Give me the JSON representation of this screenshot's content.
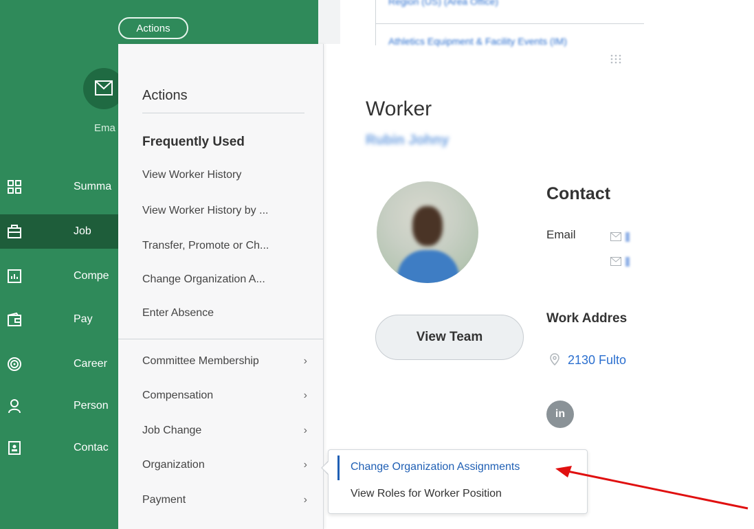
{
  "sidebar": {
    "actions_pill": "Actions",
    "email_label": "Ema",
    "items": [
      {
        "label": "Summa",
        "icon": "summary-grid-icon"
      },
      {
        "label": "Job",
        "icon": "briefcase-icon"
      },
      {
        "label": "Compe",
        "icon": "compensation-chart-icon"
      },
      {
        "label": "Pay",
        "icon": "wallet-icon"
      },
      {
        "label": "Career",
        "icon": "target-icon"
      },
      {
        "label": "Person",
        "icon": "person-icon"
      },
      {
        "label": "Contac",
        "icon": "contact-card-icon"
      }
    ],
    "active_item": "Job"
  },
  "actions_panel": {
    "title": "Actions",
    "frequently_used_heading": "Frequently Used",
    "frequently_used": [
      "View Worker History",
      "View Worker History by ...",
      "Transfer, Promote or Ch...",
      "Change Organization A...",
      "Enter Absence"
    ],
    "categories": [
      "Committee Membership",
      "Compensation",
      "Job Change",
      "Organization",
      "Payment"
    ]
  },
  "submenu": {
    "items": [
      "Change Organization Assignments",
      "View Roles for Worker Position"
    ],
    "selected_index": 0
  },
  "worker": {
    "title": "Worker",
    "name_blurred": "Rubin Johny",
    "view_team_label": "View Team",
    "contact_heading": "Contact",
    "email_label": "Email",
    "work_address_heading": "Work Addres",
    "address_link": "2130 Fulto",
    "linkedin_label": "in"
  },
  "colors": {
    "sidebar_green": "#2f8a5a",
    "sidebar_active": "#1e5d3a",
    "link_blue": "#2b6fcf",
    "annotation_red": "#e01010"
  }
}
